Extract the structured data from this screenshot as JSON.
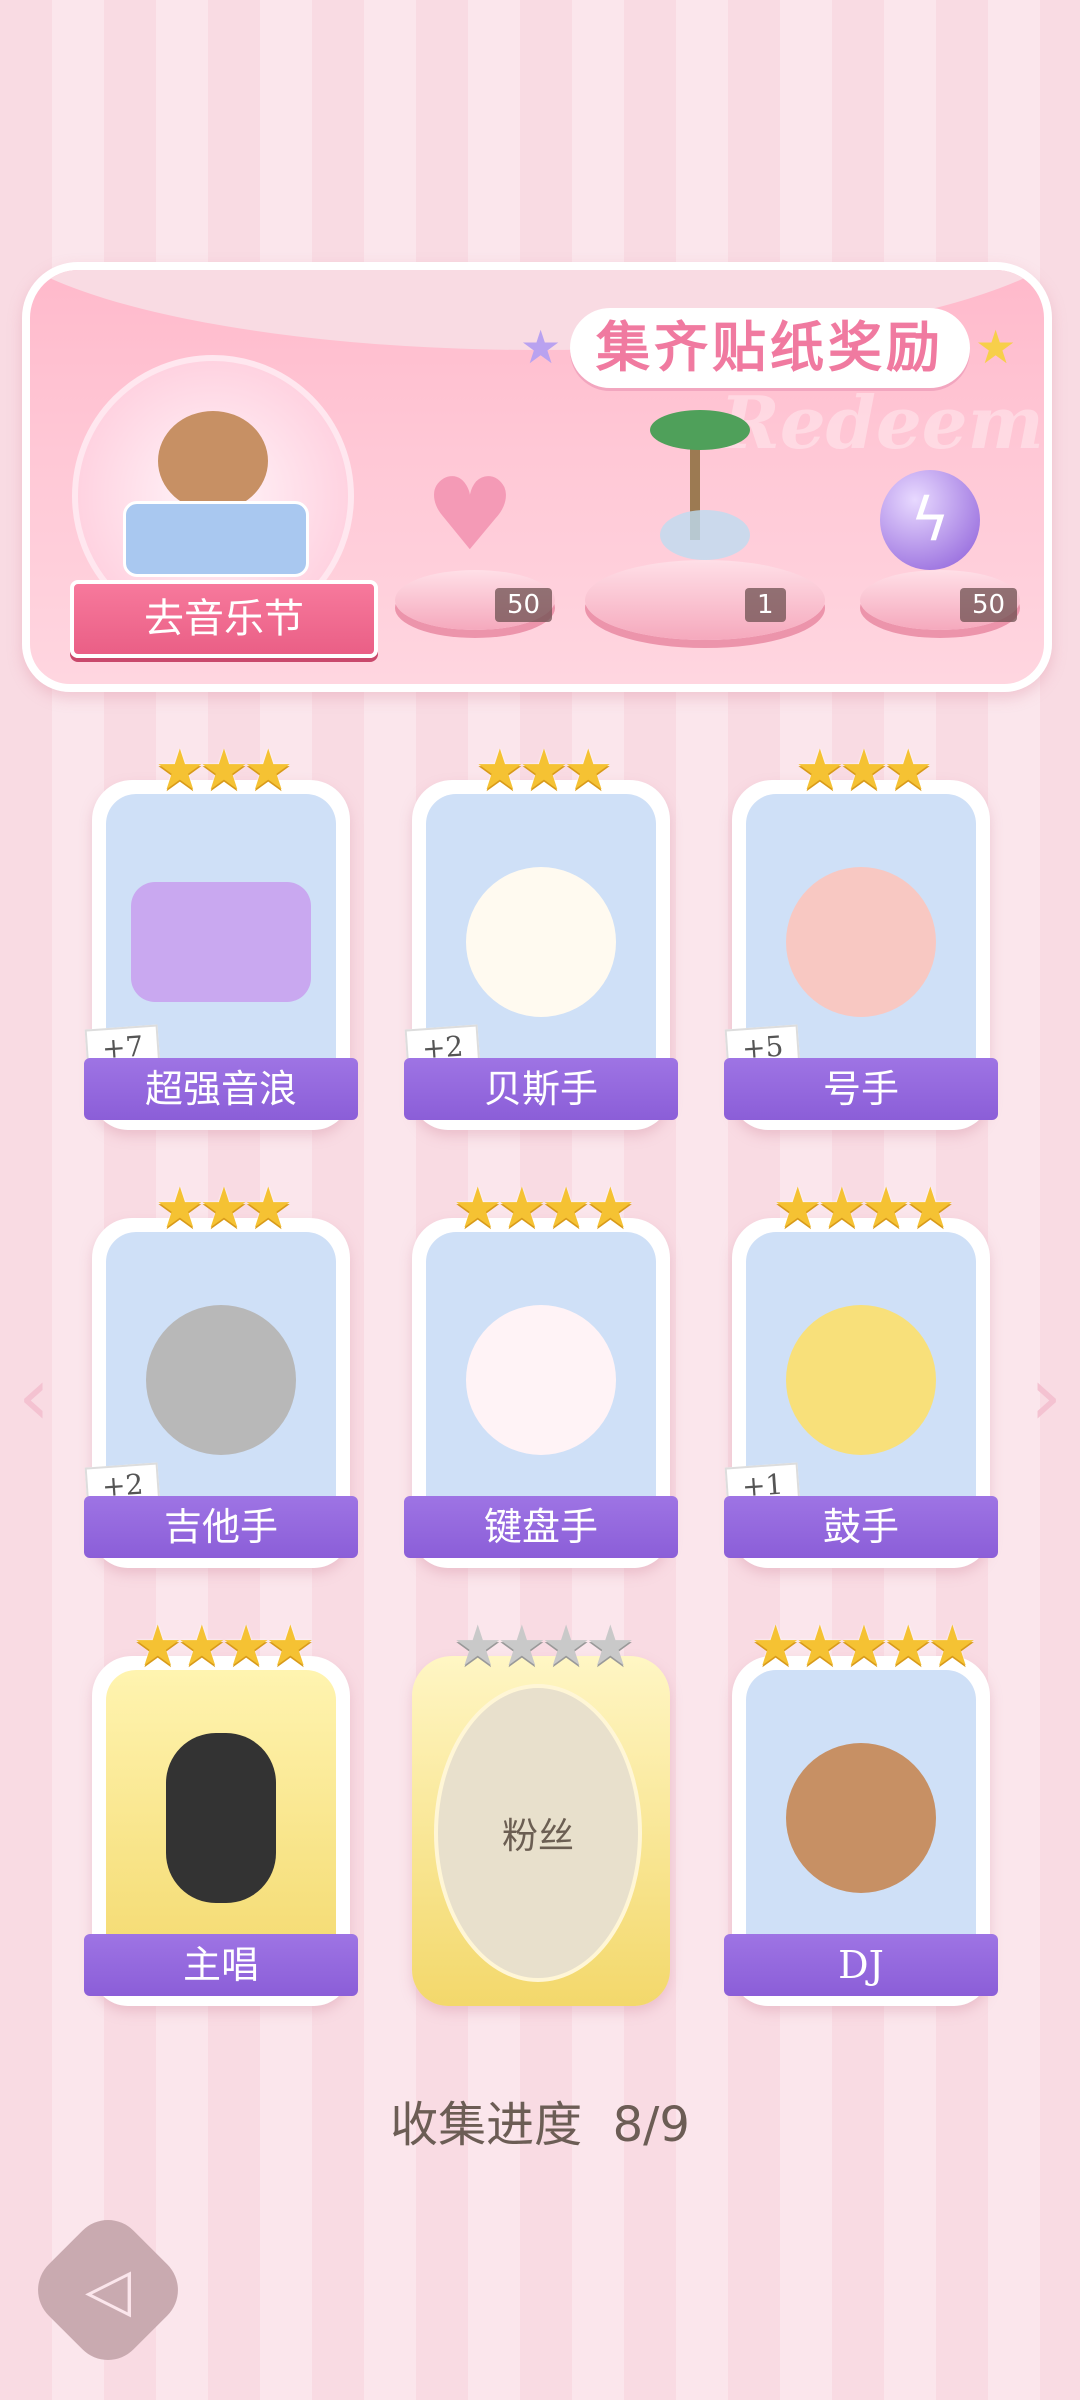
{
  "banner": {
    "title": "集齐贴纸奖励",
    "watermark": "Redeem",
    "festival_button": "去音乐节",
    "rewards": [
      {
        "icon": "pink-heart-gem-icon",
        "count": "50"
      },
      {
        "icon": "palm-island-icon",
        "count": "1"
      },
      {
        "icon": "purple-energy-orb-icon",
        "count": "50"
      }
    ]
  },
  "cards": [
    {
      "label": "超强音浪",
      "stars": 3,
      "plus": "+7",
      "icon": "boombox-icon",
      "color": "#c9a8f0"
    },
    {
      "label": "贝斯手",
      "stars": 3,
      "plus": "+2",
      "icon": "bear-bass-icon",
      "color": "#fffaf0"
    },
    {
      "label": "号手",
      "stars": 3,
      "plus": "+5",
      "icon": "pig-sax-icon",
      "color": "#f8c8c2"
    },
    {
      "label": "吉他手",
      "stars": 3,
      "plus": "+2",
      "icon": "cat-guitar-icon",
      "color": "#b8b8b8"
    },
    {
      "label": "键盘手",
      "stars": 4,
      "plus": "",
      "icon": "bunny-keytar-icon",
      "color": "#fff3f6"
    },
    {
      "label": "鼓手",
      "stars": 4,
      "plus": "+1",
      "icon": "dog-drums-icon",
      "color": "#f8e07a"
    },
    {
      "label": "主唱",
      "stars": 4,
      "plus": "",
      "icon": "singer-icon",
      "color": "#333333"
    },
    {
      "label": "粉丝",
      "stars": 4,
      "plus": "",
      "icon": "locked-slot-icon",
      "color": "#e8e0cc"
    },
    {
      "label": "DJ",
      "stars": 5,
      "plus": "",
      "icon": "bear-dj-icon",
      "color": "#c79064"
    }
  ],
  "progress": {
    "label": "收集进度",
    "value": "8/9"
  },
  "nav": {
    "left": "‹",
    "right": "›",
    "back": "◁"
  }
}
